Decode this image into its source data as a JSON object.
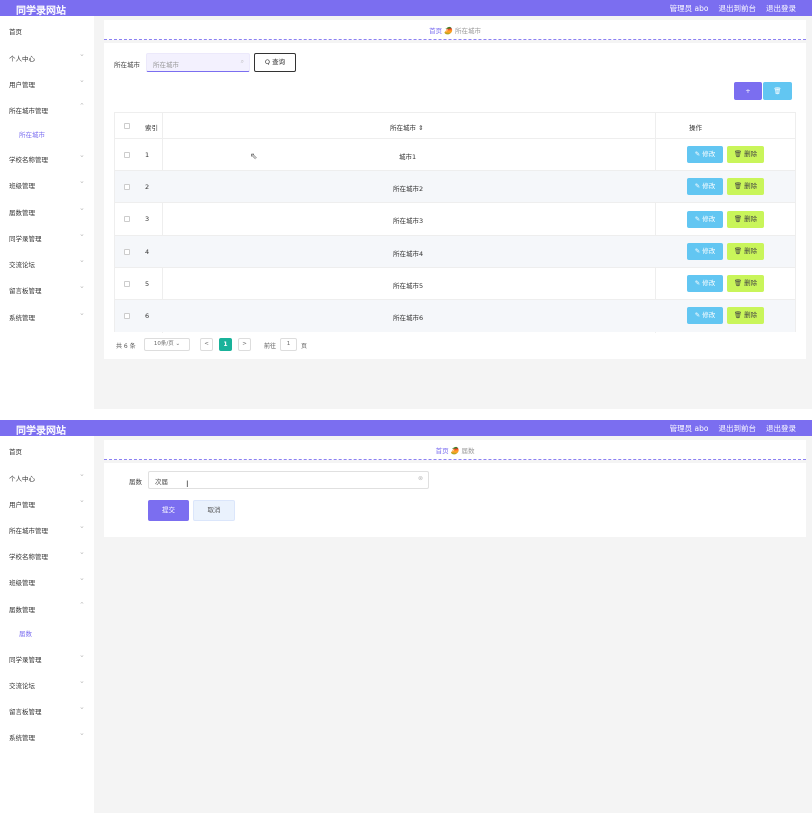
{
  "app": {
    "brand": "同学录网站",
    "topnav": [
      "管理员 abo",
      "退出到前台",
      "退出登录"
    ]
  },
  "sidebar1": {
    "items": [
      {
        "label": "首页",
        "chevron": false
      },
      {
        "label": "个人中心",
        "chevron": true
      },
      {
        "label": "用户管理",
        "chevron": true
      },
      {
        "label": "所在城市管理",
        "chevron": true
      },
      {
        "label": "所在城市",
        "sub": true
      },
      {
        "label": "学校名称管理",
        "chevron": true
      },
      {
        "label": "班级管理",
        "chevron": true
      },
      {
        "label": "届数管理",
        "chevron": true
      },
      {
        "label": "同学录管理",
        "chevron": true
      },
      {
        "label": "交流论坛",
        "chevron": true
      },
      {
        "label": "留言板管理",
        "chevron": true
      },
      {
        "label": "系统管理",
        "chevron": true
      }
    ]
  },
  "sidebar2": {
    "items": [
      {
        "label": "首页",
        "chevron": false
      },
      {
        "label": "个人中心",
        "chevron": true
      },
      {
        "label": "用户管理",
        "chevron": true
      },
      {
        "label": "所在城市管理",
        "chevron": true
      },
      {
        "label": "学校名称管理",
        "chevron": true
      },
      {
        "label": "班级管理",
        "chevron": true
      },
      {
        "label": "届数管理",
        "chevron": true
      },
      {
        "label": "届数",
        "sub": true
      },
      {
        "label": "同学录管理",
        "chevron": true
      },
      {
        "label": "交流论坛",
        "chevron": true
      },
      {
        "label": "留言板管理",
        "chevron": true
      },
      {
        "label": "系统管理",
        "chevron": true
      }
    ]
  },
  "list_page": {
    "breadcrumb": {
      "home": "首页",
      "sep": "🥭",
      "current": "所在城市"
    },
    "search": {
      "label": "所在城市",
      "placeholder": "所在城市",
      "button": "Q 查询"
    },
    "actions": {
      "add": "+",
      "delete": "🗑"
    },
    "table": {
      "headers": [
        "索引",
        "所在城市 ⇕",
        "操作"
      ],
      "rows": [
        {
          "index": "1",
          "city": "城市1"
        },
        {
          "index": "2",
          "city": "所在城市2"
        },
        {
          "index": "3",
          "city": "所在城市3"
        },
        {
          "index": "4",
          "city": "所在城市4"
        },
        {
          "index": "5",
          "city": "所在城市5"
        },
        {
          "index": "6",
          "city": "所在城市6"
        }
      ],
      "edit_label": "✎ 修改",
      "delete_label": "🗑 删除"
    },
    "pager": {
      "total": "共 6 条",
      "page_size": "10条/页",
      "prev": "<",
      "current": "1",
      "next": ">",
      "goto_label": "前往",
      "goto_value": "1",
      "goto_suffix": "页"
    }
  },
  "form_page": {
    "breadcrumb": {
      "home": "首页",
      "sep": "🥭",
      "current": "届数"
    },
    "field_label": "届数",
    "field_value": "次届",
    "submit": "提交",
    "cancel": "取消"
  },
  "colors": {
    "primary": "#7b6ef0",
    "cyan": "#62c6f2",
    "lime": "#c9f55a",
    "pager_active": "#19b29a"
  }
}
